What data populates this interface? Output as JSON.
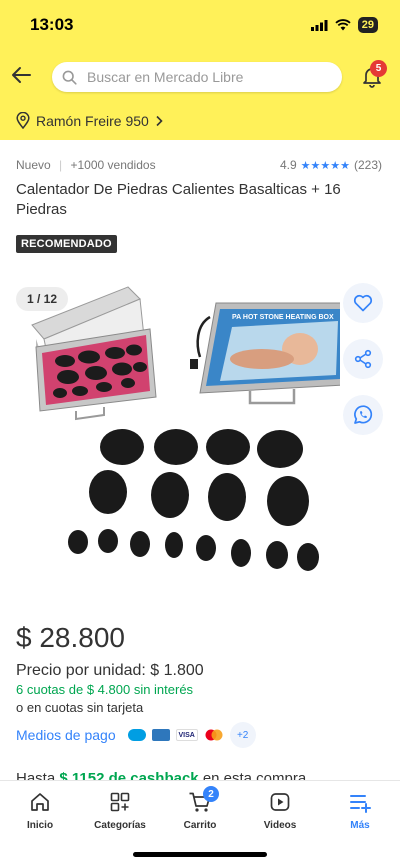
{
  "status": {
    "time": "13:03",
    "battery": "29"
  },
  "header": {
    "search_placeholder": "Buscar en Mercado Libre",
    "notifications": "5",
    "location": "Ramón Freire 950"
  },
  "product": {
    "condition": "Nuevo",
    "sold": "+1000 vendidos",
    "rating": "4.9",
    "stars": "★★★★★",
    "reviews": "(223)",
    "title": "Calentador De Piedras Calientes Basalticas + 16 Piedras",
    "badge": "RECOMENDADO",
    "gallery_counter": "1 / 12",
    "case_label": "PA HOT STONE HEATING BOX"
  },
  "pricing": {
    "price": "$ 28.800",
    "unit_price": "Precio por unidad: $ 1.800",
    "installments": "6 cuotas de $ 4.800 sin interés",
    "no_card": "o en cuotas sin tarjeta",
    "payment_link": "Medios de pago",
    "payment_more": "+2",
    "cards": [
      "VISA"
    ]
  },
  "cashback": {
    "prefix": "Hasta",
    "amount": "$ 1152 de cashback",
    "suffix": "en esta compra"
  },
  "tabs": [
    {
      "label": "Inicio"
    },
    {
      "label": "Categorías"
    },
    {
      "label": "Carrito",
      "badge": "2"
    },
    {
      "label": "Videos"
    },
    {
      "label": "Más"
    }
  ],
  "colors": {
    "brand_yellow": "#fff159",
    "accent_blue": "#3483fa",
    "green": "#00a650"
  }
}
